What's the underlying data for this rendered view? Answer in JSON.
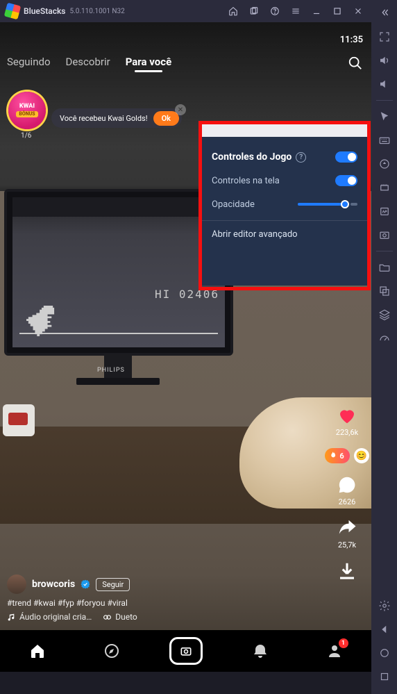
{
  "topbar": {
    "title": "BlueStacks",
    "version": "5.0.110.1001 N32"
  },
  "clock": "11:35",
  "tabs": {
    "following": "Seguindo",
    "discover": "Descobrir",
    "foryou": "Para você"
  },
  "badge": {
    "line1": "KWAI",
    "line2": "BÔNUS",
    "counter": "1/6"
  },
  "toast": {
    "text": "Você recebeu Kwai Golds!",
    "ok": "Ok"
  },
  "panel": {
    "title": "Controles do Jogo",
    "onscreen": "Controles na tela",
    "opacity": "Opacidade",
    "advanced": "Abrir editor avançado"
  },
  "game": {
    "hiscore": "HI  02406"
  },
  "monitor": {
    "brand": "PHILIPS"
  },
  "actions": {
    "likes": "223,6k",
    "fire_count": "6",
    "comments": "2626",
    "shares": "25,7k"
  },
  "meta": {
    "username": "browcoris",
    "follow": "Seguir",
    "tags": "#trend #kwai #fyp #foryou #viral",
    "audio": "Áudio original cria…",
    "dueto": "Dueto"
  },
  "nav": {
    "badge": "1"
  }
}
